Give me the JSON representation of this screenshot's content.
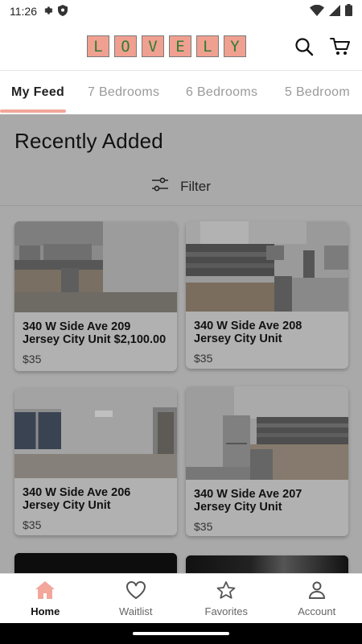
{
  "status_bar": {
    "time": "11:26"
  },
  "header": {
    "logo_letters": [
      "L",
      "O",
      "V",
      "E",
      "L",
      "Y"
    ]
  },
  "tabs": [
    {
      "label": "My Feed",
      "active": true
    },
    {
      "label": "7 Bedrooms",
      "active": false
    },
    {
      "label": "6 Bedrooms",
      "active": false
    },
    {
      "label": "5 Bedroom",
      "active": false
    }
  ],
  "main": {
    "section_title": "Recently Added",
    "filter_label": "Filter"
  },
  "listings": [
    {
      "address": "340 W Side Ave 209 Jersey City Unit $2,100.00",
      "price": "$35",
      "scene": "kitchen-empty-room"
    },
    {
      "address": "340 W Side Ave 208 Jersey City Unit",
      "price": "$35",
      "scene": "kitchen-stove"
    },
    {
      "address": "340 W Side Ave 206 Jersey City Unit",
      "price": "$35",
      "scene": "empty-bedroom"
    },
    {
      "address": "340 W Side Ave 207 Jersey City Unit",
      "price": "$35",
      "scene": "kitchen-fridge"
    }
  ],
  "bottom_nav": [
    {
      "label": "Home",
      "icon": "home-icon",
      "active": true
    },
    {
      "label": "Waitlist",
      "icon": "heart-icon",
      "active": false
    },
    {
      "label": "Favorites",
      "icon": "star-icon",
      "active": false
    },
    {
      "label": "Account",
      "icon": "person-icon",
      "active": false
    }
  ],
  "colors": {
    "accent": "#f2a79a",
    "logo_tile": "#f0a090",
    "logo_letter": "#2f7d32",
    "content_dim": "#a9a9a9"
  }
}
